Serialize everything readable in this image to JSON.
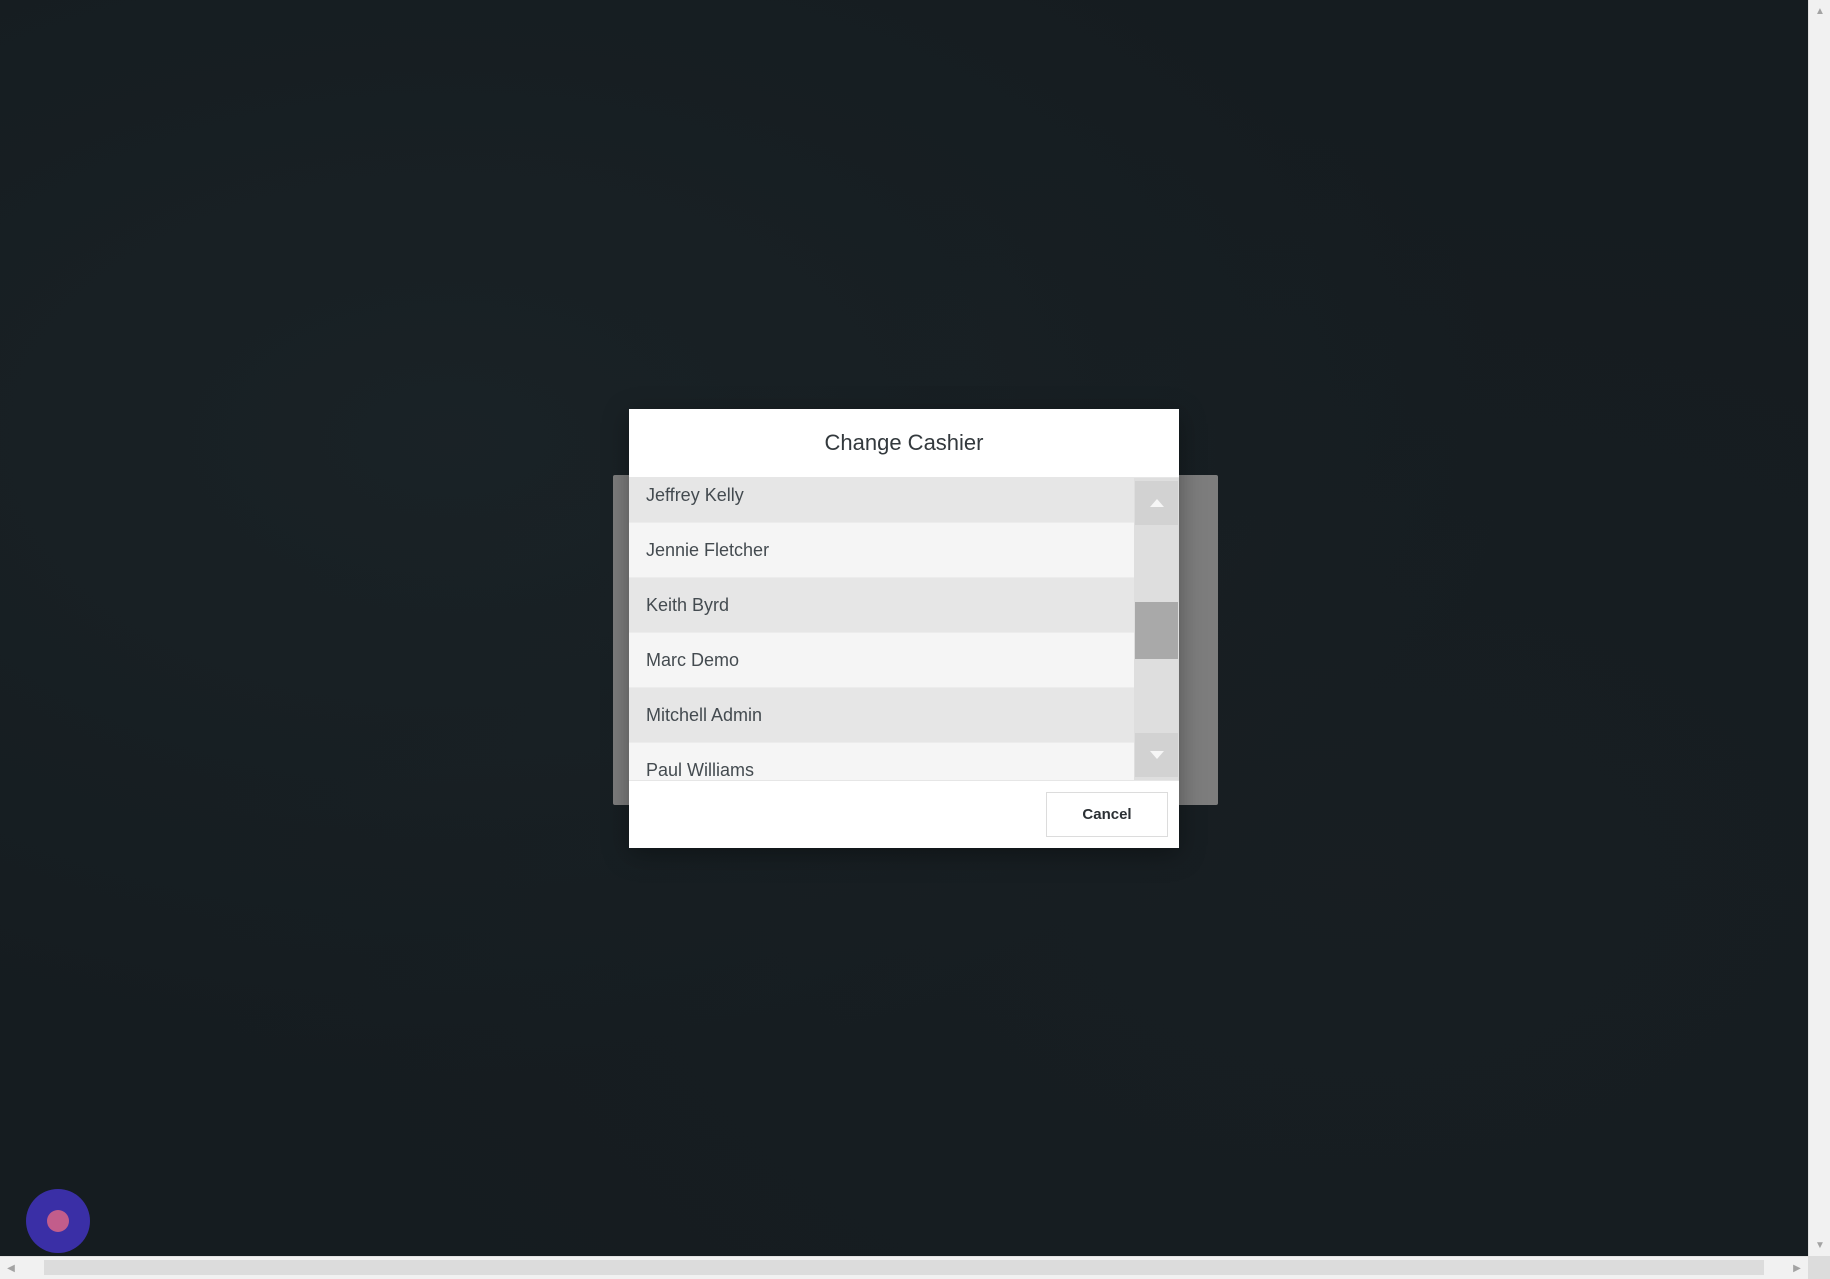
{
  "dialog": {
    "title": "Change Cashier",
    "cashiers": [
      {
        "name": "Jeffrey Kelly",
        "style": "alt"
      },
      {
        "name": "Jennie Fletcher",
        "style": "plain"
      },
      {
        "name": "Keith Byrd",
        "style": "alt"
      },
      {
        "name": "Marc Demo",
        "style": "plain"
      },
      {
        "name": "Mitchell Admin",
        "style": "alt"
      },
      {
        "name": "Paul Williams",
        "style": "plain"
      }
    ],
    "cancel_label": "Cancel"
  },
  "icons": {
    "list_up": "triangle-up-icon",
    "list_down": "triangle-down-icon",
    "page_up": "arrow-up-icon",
    "page_down": "arrow-down-icon",
    "page_left": "arrow-left-icon",
    "page_right": "arrow-right-icon",
    "fab": "record-dot-icon"
  },
  "colors": {
    "fab_background": "#3a2fa6",
    "fab_dot": "#c25d8b",
    "scroll_thumb": "#a9a9a9"
  }
}
